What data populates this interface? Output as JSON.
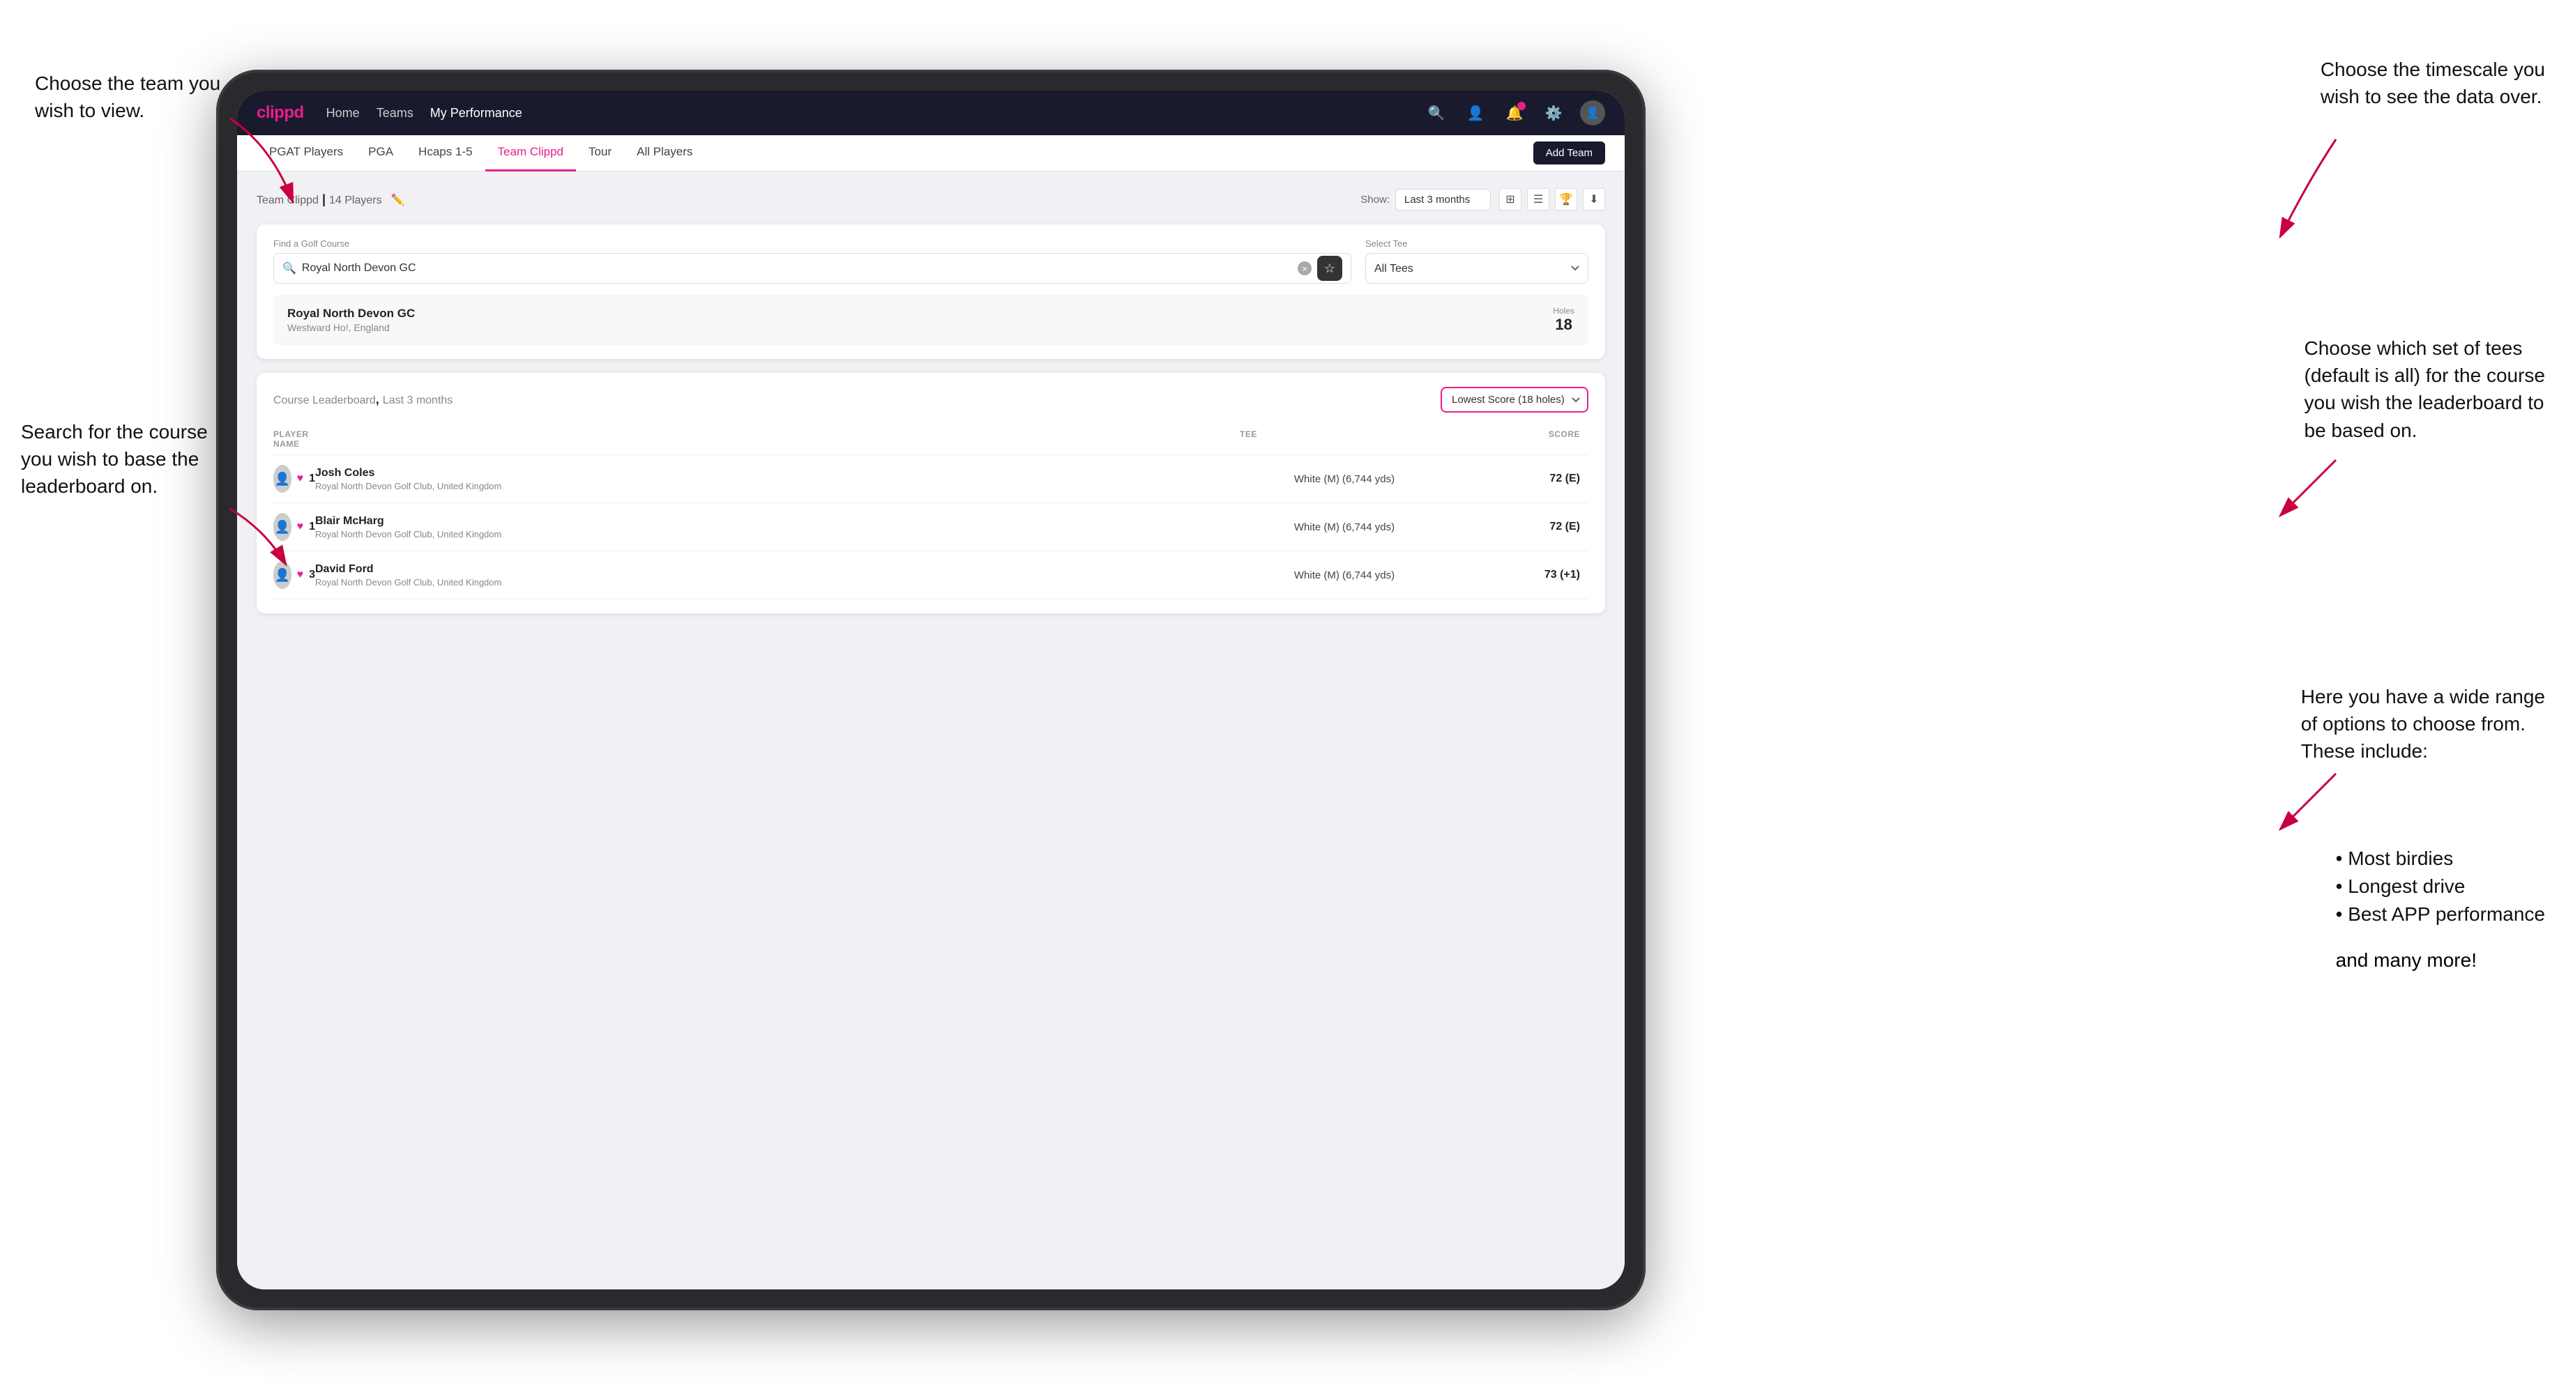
{
  "page": {
    "background": "#ffffff"
  },
  "annotations": {
    "top_left_title": "Choose the team you\nwish to view.",
    "mid_left_title": "Search for the course\nyou wish to base the\nleaderboard on.",
    "top_right_title": "Choose the timescale you\nwish to see the data over.",
    "mid_right_title": "Choose which set of tees\n(default is all) for the course\nyou wish the leaderboard to\nbe based on.",
    "bottom_right_title": "Here you have a wide range\nof options to choose from.\nThese include:",
    "bullet_1": "Most birdies",
    "bullet_2": "Longest drive",
    "bullet_3": "Best APP performance",
    "and_more": "and many more!"
  },
  "nav": {
    "logo": "clippd",
    "links": [
      "Home",
      "Teams",
      "My Performance"
    ],
    "active_link": "My Performance"
  },
  "sub_nav": {
    "items": [
      "PGAT Players",
      "PGA",
      "Hcaps 1-5",
      "Team Clippd",
      "Tour",
      "All Players"
    ],
    "active": "Team Clippd",
    "add_team_label": "Add Team"
  },
  "team_header": {
    "title": "Team Clippd",
    "count": "14 Players",
    "show_label": "Show:",
    "show_value": "Last 3 months"
  },
  "search_section": {
    "find_label": "Find a Golf Course",
    "find_placeholder": "Royal North Devon GC",
    "tee_label": "Select Tee",
    "tee_value": "All Tees"
  },
  "course_result": {
    "name": "Royal North Devon GC",
    "location": "Westward Ho!, England",
    "holes_label": "Holes",
    "holes_value": "18"
  },
  "leaderboard": {
    "title": "Course Leaderboard",
    "subtitle": "Last 3 months",
    "score_dropdown": "Lowest Score (18 holes)",
    "columns": [
      "PLAYER NAME",
      "TEE",
      "SCORE"
    ],
    "players": [
      {
        "rank": "1",
        "name": "Josh Coles",
        "club": "Royal North Devon Golf Club, United Kingdom",
        "tee": "White (M) (6,744 yds)",
        "score": "72 (E)"
      },
      {
        "rank": "1",
        "name": "Blair McHarg",
        "club": "Royal North Devon Golf Club, United Kingdom",
        "tee": "White (M) (6,744 yds)",
        "score": "72 (E)"
      },
      {
        "rank": "3",
        "name": "David Ford",
        "club": "Royal North Devon Golf Club, United Kingdom",
        "tee": "White (M) (6,744 yds)",
        "score": "73 (+1)"
      }
    ]
  }
}
